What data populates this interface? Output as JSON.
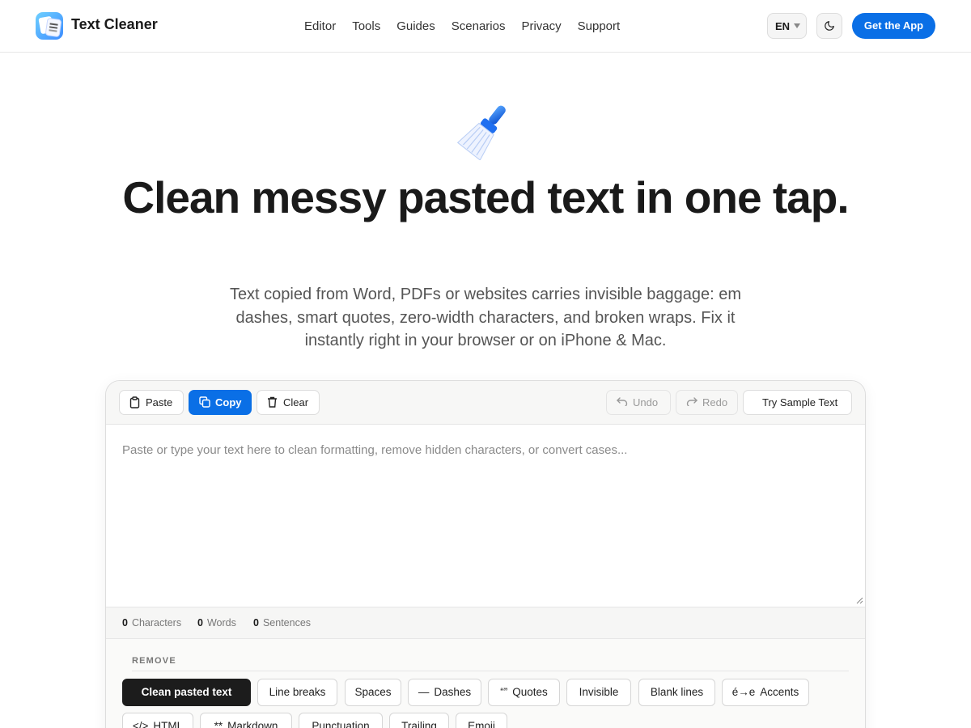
{
  "header": {
    "brand": "Text Cleaner",
    "nav": [
      "Editor",
      "Tools",
      "Guides",
      "Scenarios",
      "Privacy",
      "Support"
    ],
    "language": "EN",
    "cta_label": "Get the App",
    "theme_icon": "moon-icon"
  },
  "hero": {
    "icon": "broom-icon",
    "title": "Clean messy pasted text in one tap.",
    "subtitle": "Text copied from Word, PDFs or websites carries invisible baggage: em dashes, smart quotes, zero-width characters, and broken wraps. Fix it instantly right in your browser or on iPhone & Mac."
  },
  "editor": {
    "toolbar": {
      "paste": "Paste",
      "copy": "Copy",
      "clear": "Clear",
      "undo": "Undo",
      "redo": "Redo",
      "sample": "Try Sample Text"
    },
    "placeholder": "Paste or type your text here to clean formatting, remove hidden characters, or convert cases...",
    "stats": {
      "characters_count": "0",
      "characters_label": "Characters",
      "words_count": "0",
      "words_label": "Words",
      "sentences_count": "0",
      "sentences_label": "Sentences"
    },
    "remove_section": {
      "label": "REMOVE",
      "chips": [
        {
          "glyph": "",
          "label": "Clean pasted text",
          "active": true
        },
        {
          "glyph": "",
          "label": "Line breaks"
        },
        {
          "glyph": "",
          "label": "Spaces"
        },
        {
          "glyph": "—",
          "label": "Dashes"
        },
        {
          "glyph": "“”",
          "label": "Quotes"
        },
        {
          "glyph": "",
          "label": "Invisible"
        },
        {
          "glyph": "",
          "label": "Blank lines"
        },
        {
          "glyph": "é→e",
          "label": "Accents"
        },
        {
          "glyph": "</>",
          "label": "HTML"
        },
        {
          "glyph": "**",
          "label": "Markdown"
        },
        {
          "glyph": "",
          "label": "Punctuation"
        },
        {
          "glyph": "",
          "label": "Trailing"
        },
        {
          "glyph": "",
          "label": "Emoji"
        }
      ]
    }
  },
  "colors": {
    "accent": "#0a6fe6",
    "active_chip": "#1c1c1c"
  }
}
